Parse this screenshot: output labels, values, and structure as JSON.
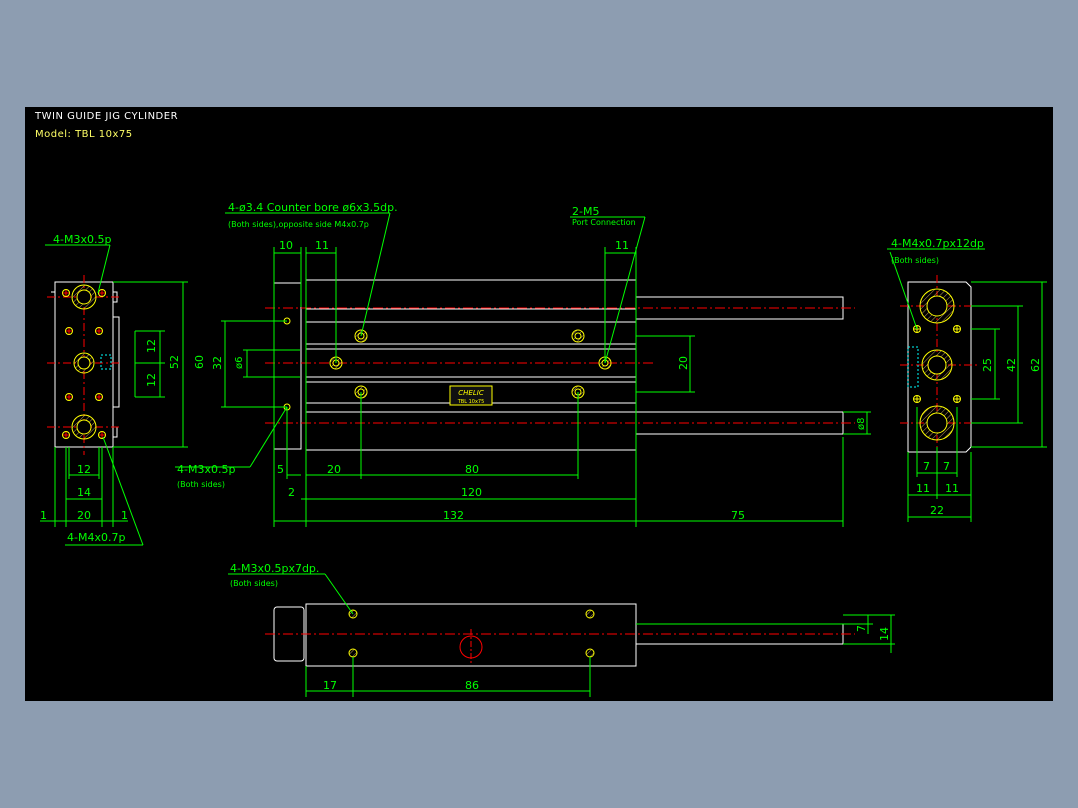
{
  "header": {
    "title": "TWIN GUIDE JIG CYLINDER",
    "model": "Model: TBL 10x75"
  },
  "colors": {
    "background": "#8d9db1",
    "drawing_bg": "#000000",
    "dimension": "#00ff00",
    "geometry": "#ffffff",
    "centerline": "#ff0000",
    "holes": "#ffff00",
    "hatch": "#00ffff"
  },
  "callouts": {
    "left_top": "4-M3x0.5p",
    "left_bottom": "4-M4x0.7p",
    "cbore_1": "4-ø3.4 Counter bore ø6x3.5dp.",
    "cbore_2": "(Both sides),opposite side M4x0.7p",
    "port_1": "2-M5",
    "port_2": "Port Connection",
    "front_tap_1": "4-M3x0.5p",
    "front_tap_2": "(Both sides)",
    "right_tap_1": "4-M4x0.7px12dp",
    "right_tap_2": "(Both sides)",
    "bottom_tap_1": "4-M3x0.5px7dp.",
    "bottom_tap_2": "(Both sides)"
  },
  "dims": {
    "l_12a": "12",
    "l_12b": "12",
    "l_52": "52",
    "l_60": "60",
    "l_12w": "12",
    "l_14w": "14",
    "l_20w": "20",
    "l_1a": "1",
    "l_1b": "1",
    "f_10": "10",
    "f_11a": "11",
    "f_11b": "11",
    "f_32": "32",
    "f_d6": "ø6",
    "f_20v": "20",
    "f_d8": "ø8",
    "f_5": "5",
    "f_2": "2",
    "f_20": "20",
    "f_80": "80",
    "f_120": "120",
    "f_132": "132",
    "f_75": "75",
    "r_25": "25",
    "r_42": "42",
    "r_62": "62",
    "r_7a": "7",
    "r_7b": "7",
    "r_11a": "11",
    "r_11b": "11",
    "r_22": "22",
    "b_7": "7",
    "b_14": "14",
    "b_17": "17",
    "b_86": "86"
  },
  "nameplate": {
    "brand": "CHELIC",
    "line2": "TBL 10x75"
  }
}
